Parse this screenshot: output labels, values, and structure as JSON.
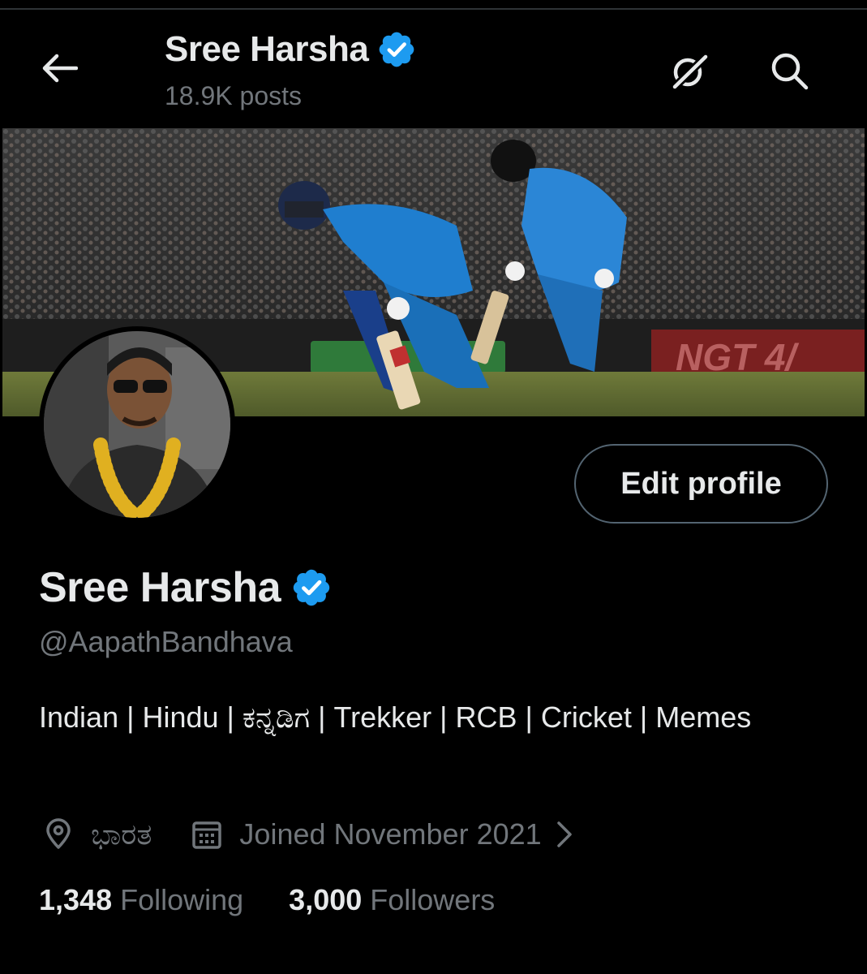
{
  "header": {
    "name": "Sree Harsha",
    "posts_count": "18.9K posts"
  },
  "profile": {
    "name": "Sree Harsha",
    "handle": "@AapathBandhava",
    "bio": "Indian | Hindu | ಕನ್ನಡಿಗ | Trekker | RCB | Cricket | Memes",
    "location": "ಭಾರತ",
    "joined": "Joined November 2021",
    "edit_button": "Edit profile",
    "following_count": "1,348",
    "following_label": "Following",
    "followers_count": "3,000",
    "followers_label": "Followers"
  },
  "icons": {
    "back": "arrow-left-icon",
    "grok": "grok-icon",
    "search": "search-icon",
    "verified": "verified-badge-icon",
    "location": "location-pin-icon",
    "calendar": "calendar-icon",
    "chevron": "chevron-right-icon"
  },
  "colors": {
    "background": "#000000",
    "text_primary": "#e7e9ea",
    "text_secondary": "#71767b",
    "verified_blue": "#1d9bf0",
    "button_border": "#536471"
  }
}
